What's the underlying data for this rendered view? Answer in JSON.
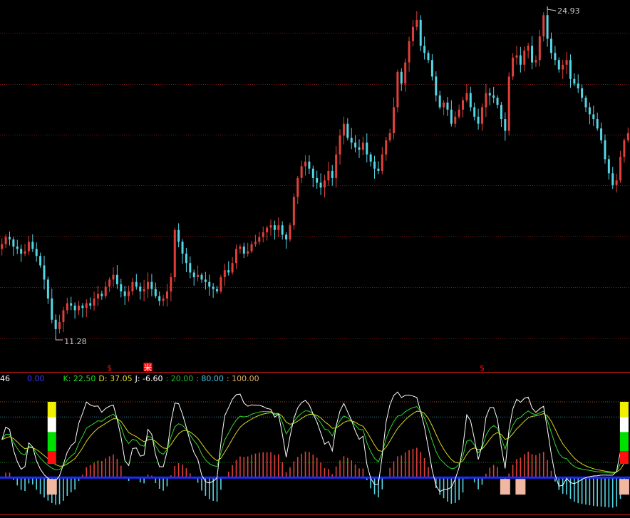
{
  "colors": {
    "background": "#000000",
    "up": "#e0403a",
    "down": "#55d6e6",
    "grid": "#7a1818",
    "separator": "#c01818",
    "white": "#ffffff",
    "yellow": "#f0f000",
    "green": "#00e000",
    "red": "#ff1010",
    "blue": "#1a2cff",
    "peach": "#f0b8a0",
    "label": "#c8c8c8"
  },
  "chart_data": [
    {
      "type": "candlestick",
      "title": "",
      "annotations": {
        "high_label": "24.93",
        "low_label": "11.28"
      },
      "ylim": [
        10.0,
        25.3
      ],
      "markers": [
        {
          "text": "$",
          "index": 28
        },
        {
          "text": "米",
          "index": 38
        },
        {
          "text": "$",
          "index": 125
        }
      ],
      "close": [
        15.2,
        15.5,
        15.4,
        15.1,
        15.0,
        14.8,
        14.9,
        15.3,
        15.0,
        14.7,
        14.3,
        13.7,
        12.9,
        12.0,
        11.6,
        11.9,
        12.4,
        12.7,
        12.6,
        12.4,
        12.6,
        12.5,
        12.7,
        12.6,
        12.9,
        13.1,
        13.0,
        13.4,
        13.7,
        13.9,
        13.5,
        13.2,
        13.0,
        13.2,
        13.6,
        13.4,
        13.2,
        13.3,
        13.6,
        13.3,
        13.0,
        12.8,
        12.9,
        13.2,
        13.8,
        15.8,
        15.3,
        14.8,
        14.4,
        14.0,
        13.8,
        13.9,
        13.7,
        13.6,
        13.4,
        13.3,
        13.2,
        13.8,
        14.1,
        14.0,
        14.4,
        15.0,
        15.1,
        14.8,
        14.9,
        15.2,
        15.3,
        15.5,
        15.7,
        15.9,
        16.0,
        15.8,
        16.0,
        15.6,
        15.4,
        16.0,
        17.2,
        18.0,
        18.5,
        18.7,
        18.4,
        18.0,
        17.8,
        17.6,
        17.9,
        18.3,
        18.0,
        19.0,
        19.8,
        20.3,
        19.7,
        19.5,
        19.3,
        19.2,
        19.5,
        19.0,
        18.7,
        18.4,
        18.3,
        19.0,
        19.6,
        19.9,
        21.0,
        22.5,
        22.0,
        22.9,
        23.8,
        24.4,
        24.7,
        23.6,
        23.3,
        23.0,
        22.3,
        21.5,
        21.0,
        21.2,
        20.9,
        20.3,
        20.6,
        20.9,
        21.3,
        21.6,
        21.0,
        20.6,
        20.3,
        21.0,
        21.6,
        21.5,
        21.4,
        21.1,
        20.5,
        20.0,
        22.3,
        23.1,
        23.2,
        22.8,
        23.4,
        23.6,
        22.9,
        23.0,
        24.0,
        24.9,
        23.9,
        23.3,
        23.0,
        22.6,
        22.8,
        23.0,
        22.2,
        22.0,
        21.8,
        21.4,
        21.0,
        20.7,
        20.5,
        20.1,
        19.6,
        18.8,
        18.2,
        17.7,
        17.9,
        18.9,
        19.6,
        19.9
      ]
    },
    {
      "type": "indicator",
      "name": "KDJ",
      "legend": [
        {
          "text": "46",
          "color": "#ffffff"
        },
        {
          "text": "0.00",
          "color": "#3838ff"
        },
        {
          "text": "K: 22.50",
          "color": "#20e020"
        },
        {
          "text": "D: 37.05",
          "color": "#e0e020"
        },
        {
          "text": "J: -6.60",
          "color": "#ffffff"
        },
        {
          "text": ": 20.00",
          "color": "#20c020"
        },
        {
          "text": ": 80.00",
          "color": "#40c8e0"
        },
        {
          "text": ": 100.00",
          "color": "#e0b060"
        }
      ],
      "reference_levels": [
        0,
        20,
        80,
        100
      ],
      "ylim": [
        -45,
        115
      ],
      "signal_bars_at": [
        13,
        162
      ],
      "peach_boxes_at": [
        13,
        131,
        135,
        162
      ]
    }
  ]
}
